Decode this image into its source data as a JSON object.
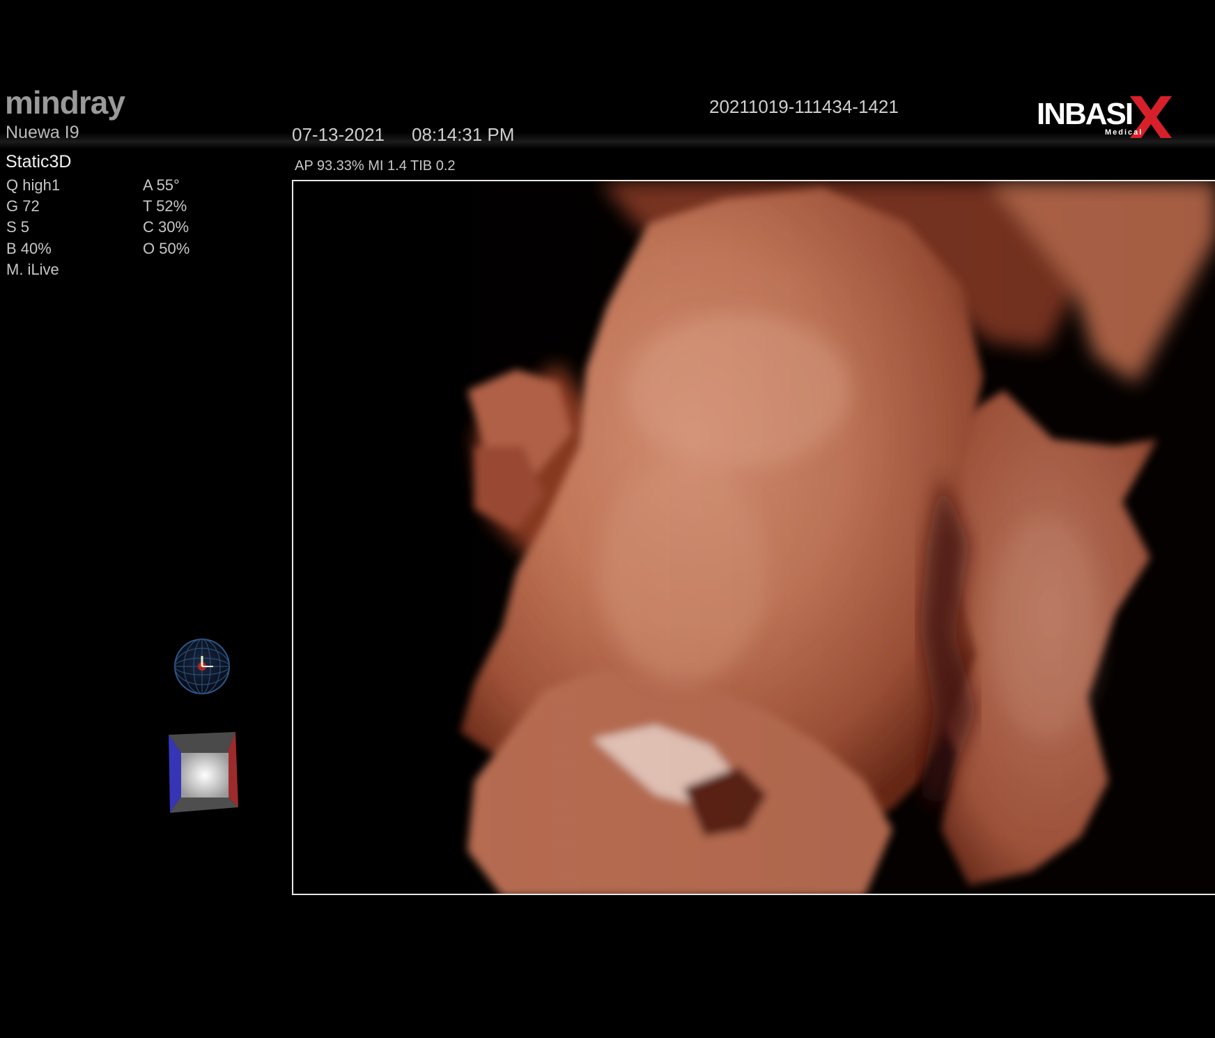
{
  "header": {
    "brand": "mindray",
    "model": "Nuewa I9",
    "date": "07-13-2021",
    "time": "08:14:31 PM",
    "study_id": "20211019-111434-1421",
    "logo_text": "INBASIX",
    "logo_sub": "Medical"
  },
  "mode": "Static3D",
  "parameters_left": [
    "Q high1",
    "G 72",
    "S 5",
    "B 40%",
    "M. iLive"
  ],
  "parameters_right": [
    "A 55°",
    "T 52%",
    "C 30%",
    "O 50%"
  ],
  "acoustic": "AP 93.33%   MI 1.4 TIB 0.2",
  "colors": {
    "background": "#000000",
    "render_tone": "#c9795c",
    "render_shadow": "#5a2012",
    "logo_red": "#d8202a",
    "cube_blue": "#3535b5",
    "cube_red": "#9e2b2b"
  },
  "icons": [
    "orientation-sphere-icon",
    "volume-cube-icon",
    "grayscale-bar-icon"
  ]
}
